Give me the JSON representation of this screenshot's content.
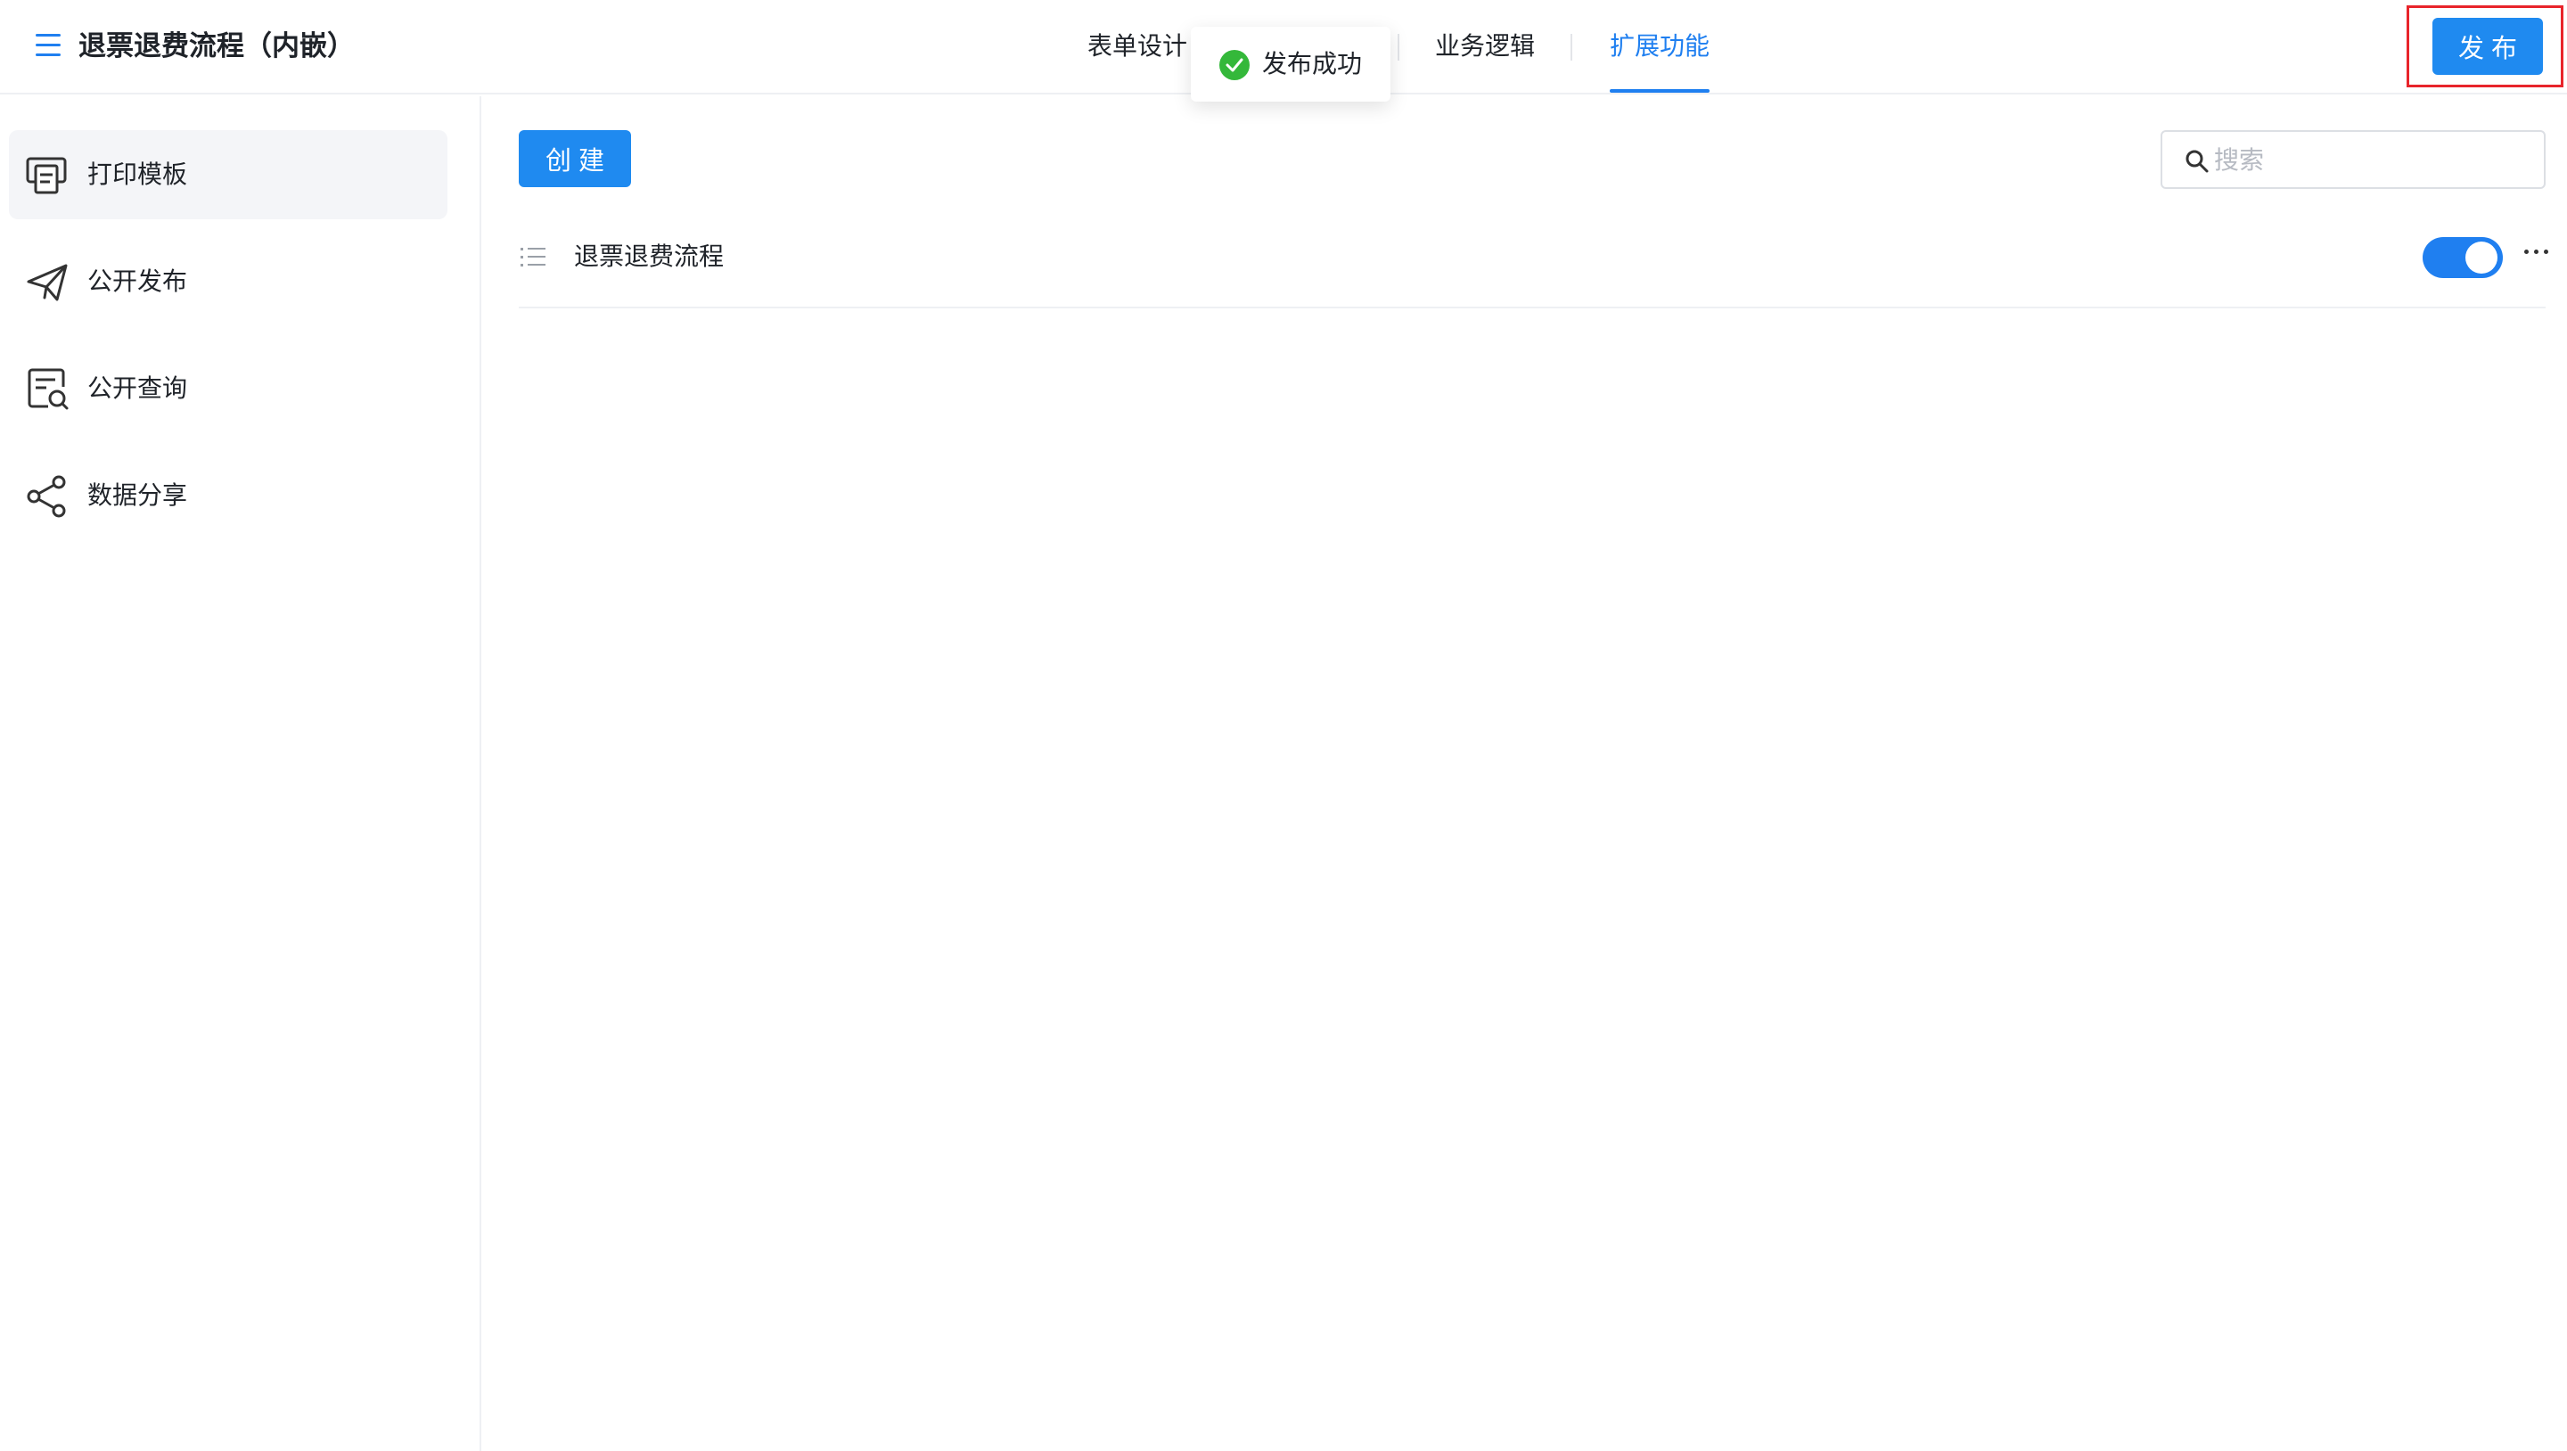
{
  "header": {
    "title": "退票退费流程（内嵌）",
    "tabs": [
      {
        "label": "表单设计",
        "active": false
      },
      {
        "label": "业务逻辑",
        "active": false
      },
      {
        "label": "扩展功能",
        "active": true
      }
    ],
    "publish_label": "发布"
  },
  "toast": {
    "message": "发布成功",
    "icon": "check-circle-icon",
    "color": "#34b83a"
  },
  "sidebar": {
    "items": [
      {
        "label": "打印模板",
        "icon": "print-template-icon",
        "active": true
      },
      {
        "label": "公开发布",
        "icon": "paper-plane-icon",
        "active": false
      },
      {
        "label": "公开查询",
        "icon": "form-search-icon",
        "active": false
      },
      {
        "label": "数据分享",
        "icon": "share-icon",
        "active": false
      }
    ]
  },
  "main": {
    "create_label": "创建",
    "search": {
      "placeholder": "搜索",
      "value": ""
    },
    "templates": [
      {
        "name": "退票退费流程",
        "enabled": true
      }
    ]
  },
  "colors": {
    "accent": "#1f7ff0",
    "button": "#1f8af0",
    "highlight": "#e8242b"
  }
}
